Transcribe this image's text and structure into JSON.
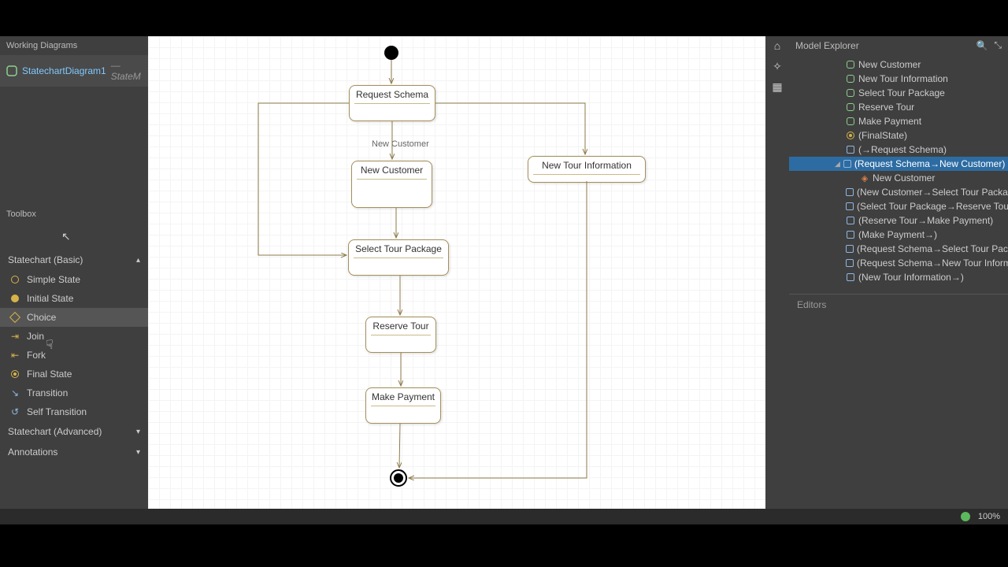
{
  "left": {
    "working_diagrams_label": "Working Diagrams",
    "open_tab": {
      "name": "StatechartDiagram1",
      "kind": "— StateM"
    },
    "toolbox_label": "Toolbox",
    "sections": {
      "basic": {
        "title": "Statechart (Basic)",
        "items": [
          {
            "label": "Simple State",
            "icon": "simple-state-icon"
          },
          {
            "label": "Initial State",
            "icon": "initial-state-icon"
          },
          {
            "label": "Choice",
            "icon": "choice-icon",
            "hover": true
          },
          {
            "label": "Join",
            "icon": "join-icon"
          },
          {
            "label": "Fork",
            "icon": "fork-icon"
          },
          {
            "label": "Final State",
            "icon": "final-state-icon"
          },
          {
            "label": "Transition",
            "icon": "transition-icon"
          },
          {
            "label": "Self Transition",
            "icon": "self-transition-icon"
          }
        ]
      },
      "advanced": {
        "title": "Statechart (Advanced)"
      },
      "annotations": {
        "title": "Annotations"
      }
    }
  },
  "diagram": {
    "edge_label": "New Customer",
    "states": {
      "request_schema": "Request Schema",
      "new_customer": "New Customer",
      "new_tour_info": "New Tour Information",
      "select_tour_package": "Select Tour Package",
      "reserve_tour": "Reserve Tour",
      "make_payment": "Make Payment"
    }
  },
  "right": {
    "header": "Model Explorer",
    "tree": [
      {
        "label": "New Customer",
        "icon": "state",
        "indent": 1
      },
      {
        "label": "New Tour Information",
        "icon": "state",
        "indent": 1
      },
      {
        "label": "Select Tour Package",
        "icon": "state",
        "indent": 1
      },
      {
        "label": "Reserve Tour",
        "icon": "state",
        "indent": 1
      },
      {
        "label": "Make Payment",
        "icon": "state",
        "indent": 1
      },
      {
        "label": "(FinalState)",
        "icon": "final",
        "indent": 1
      },
      {
        "label": "(→Request Schema)",
        "icon": "trans",
        "indent": 1
      },
      {
        "label": "(Request Schema→New Customer)",
        "icon": "trans",
        "indent": 1,
        "selected": true,
        "expanded": true
      },
      {
        "label": "New Customer",
        "icon": "tag",
        "indent": 2
      },
      {
        "label": "(New Customer→Select Tour Package)",
        "icon": "trans",
        "indent": 1
      },
      {
        "label": "(Select Tour Package→Reserve Tour)",
        "icon": "trans",
        "indent": 1
      },
      {
        "label": "(Reserve Tour→Make Payment)",
        "icon": "trans",
        "indent": 1
      },
      {
        "label": "(Make Payment→)",
        "icon": "trans",
        "indent": 1
      },
      {
        "label": "(Request Schema→Select Tour Package)",
        "icon": "trans",
        "indent": 1
      },
      {
        "label": "(Request Schema→New Tour Information)",
        "icon": "trans",
        "indent": 1
      },
      {
        "label": "(New Tour Information→)",
        "icon": "trans",
        "indent": 1
      }
    ],
    "editors_label": "Editors"
  },
  "status": {
    "zoom": "100%"
  }
}
